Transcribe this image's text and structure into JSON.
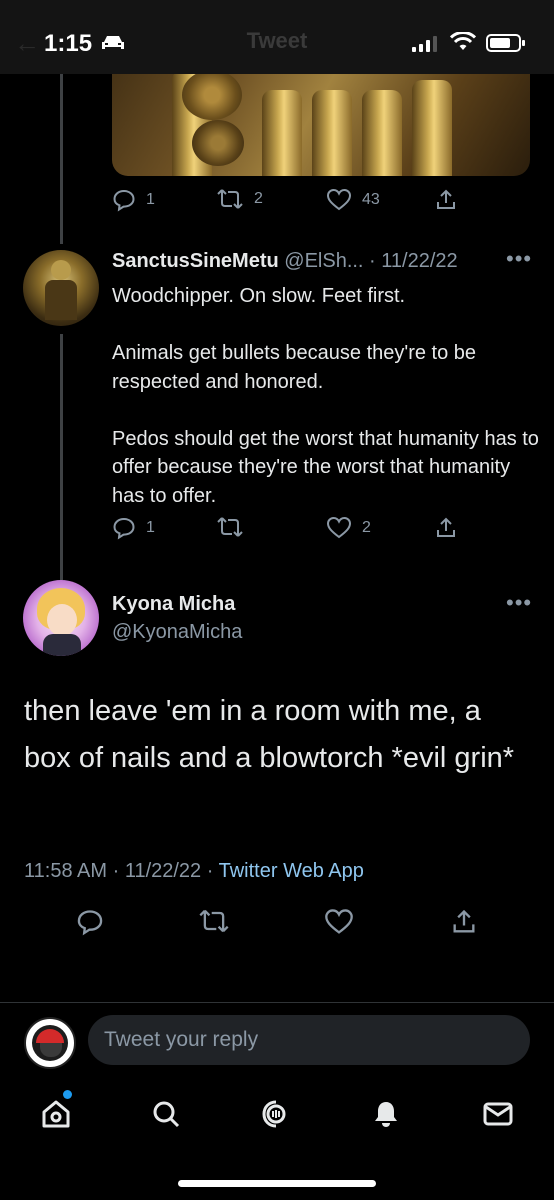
{
  "status_bar": {
    "time": "1:15",
    "header_title": "Tweet"
  },
  "previous_tweet": {
    "actions": {
      "replies": "1",
      "retweets": "2",
      "likes": "43"
    }
  },
  "reply_tweet": {
    "display_name": "SanctusSineMetu",
    "handle": "@ElSh...",
    "separator": "·",
    "date": "11/22/22",
    "paragraphs": [
      "Woodchipper. On slow. Feet first.",
      "Animals get bullets because they're to be respected and honored.",
      "Pedos should get the worst that humanity has to offer because they're the worst that humanity has to offer."
    ],
    "actions": {
      "replies": "1",
      "retweets": "",
      "likes": "2"
    }
  },
  "main_tweet": {
    "display_name": "Kyona Micha",
    "handle": "@KyonaMicha",
    "text": "then leave 'em in a room with me, a box of nails and a blowtorch *evil grin*",
    "time": "11:58 AM",
    "date": "11/22/22",
    "source": "Twitter Web App",
    "separator": " · "
  },
  "reply_composer": {
    "placeholder": "Tweet your reply"
  },
  "colors": {
    "background": "#000000",
    "muted": "#8b98a5",
    "accent": "#1d9bf0",
    "link": "#8fc6ef"
  },
  "icons": [
    "car-icon",
    "signal-icon",
    "wifi-icon",
    "battery-icon",
    "reply-icon",
    "retweet-icon",
    "like-icon",
    "share-icon",
    "more-icon",
    "home-icon",
    "search-icon",
    "spaces-icon",
    "notifications-icon",
    "messages-icon"
  ]
}
